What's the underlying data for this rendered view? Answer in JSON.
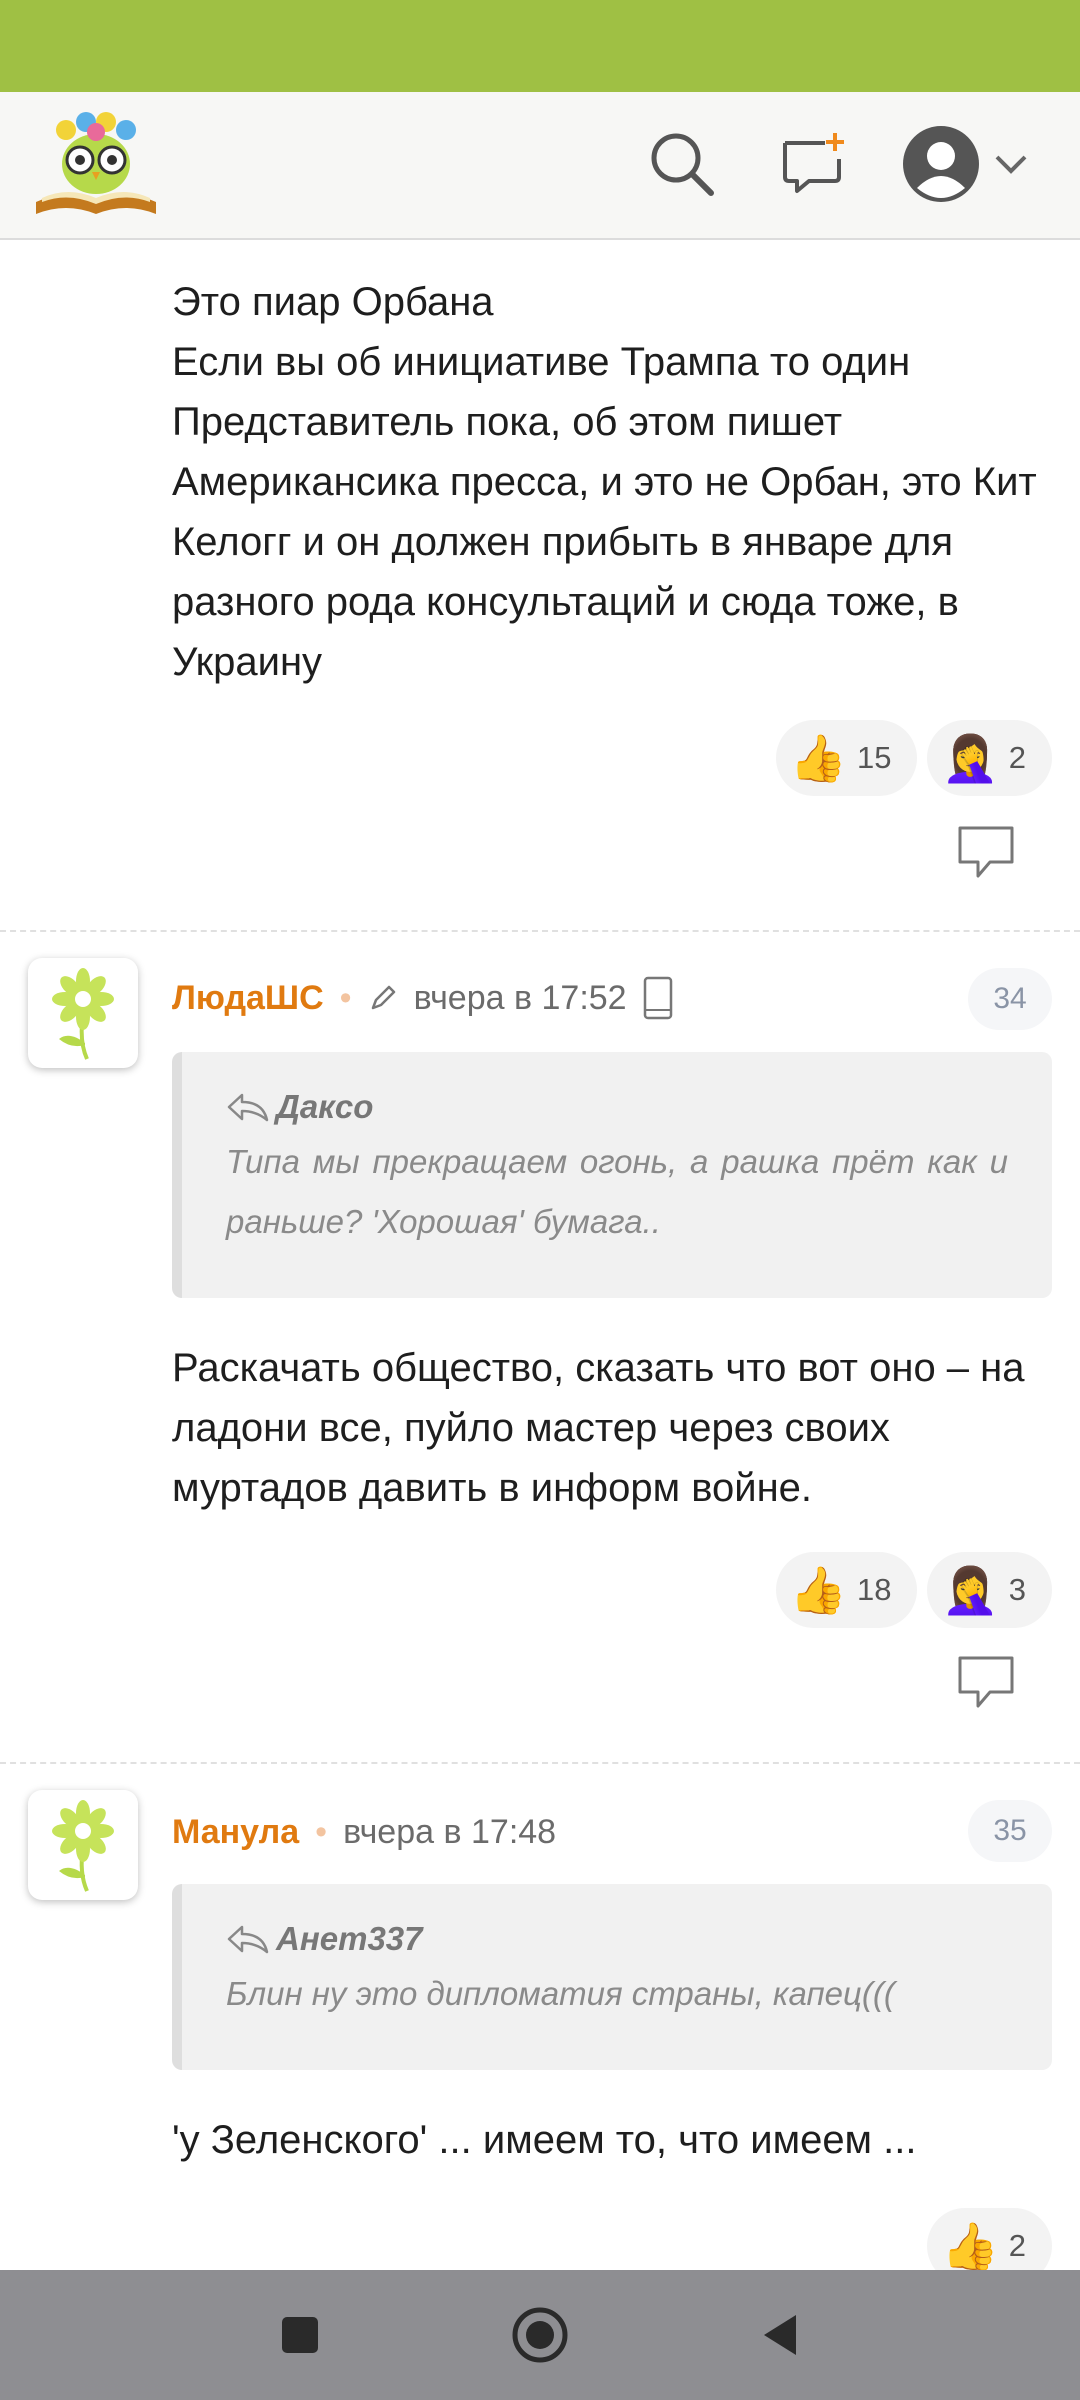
{
  "colors": {
    "status_bar": "#9fc044",
    "author": "#e07a10",
    "nav_bar": "#8e8e92"
  },
  "icons": {
    "logo": "owl-book-logo",
    "search": "search-icon",
    "new_post": "new-post-icon",
    "profile": "user-avatar-icon",
    "reply": "reply-bubble-icon",
    "avatar": "flower-avatar"
  },
  "post_top": {
    "text": "Это пиар Орбана\nЕсли вы об инициативе Трампа то один Представитель пока, об этом пишет Американсика пресса, и это не Орбан, это Кит Келогг и он должен прибыть в январе для разного рода консультаций и сюда тоже, в Украину",
    "reactions": [
      {
        "emoji": "👍",
        "count": "15"
      },
      {
        "emoji": "🤦‍♀️",
        "count": "2"
      }
    ]
  },
  "comments": [
    {
      "author": "ЛюдаШС",
      "time": "вчера в 17:52",
      "number": "34",
      "quote_author": "Даксо",
      "quote_text": "Типа мы прекращаем огонь, а рашка прёт как и раньше? 'Хорошая' бумага..",
      "text": "Раскачать общество, сказать что вот оно – на ладони все, пуйло мастер через своих муртадов давить в информ войне.",
      "reactions": [
        {
          "emoji": "👍",
          "count": "18"
        },
        {
          "emoji": "🤦‍♀️",
          "count": "3"
        }
      ]
    },
    {
      "author": "Манула",
      "time": "вчера в 17:48",
      "number": "35",
      "quote_author": "Анет337",
      "quote_text": "Блин ну это дипломатия страны, капец(((",
      "text": "'у Зеленского' ... имеем то, что имеем ...",
      "reactions": [
        {
          "emoji": "👍",
          "count": "2"
        }
      ]
    }
  ]
}
